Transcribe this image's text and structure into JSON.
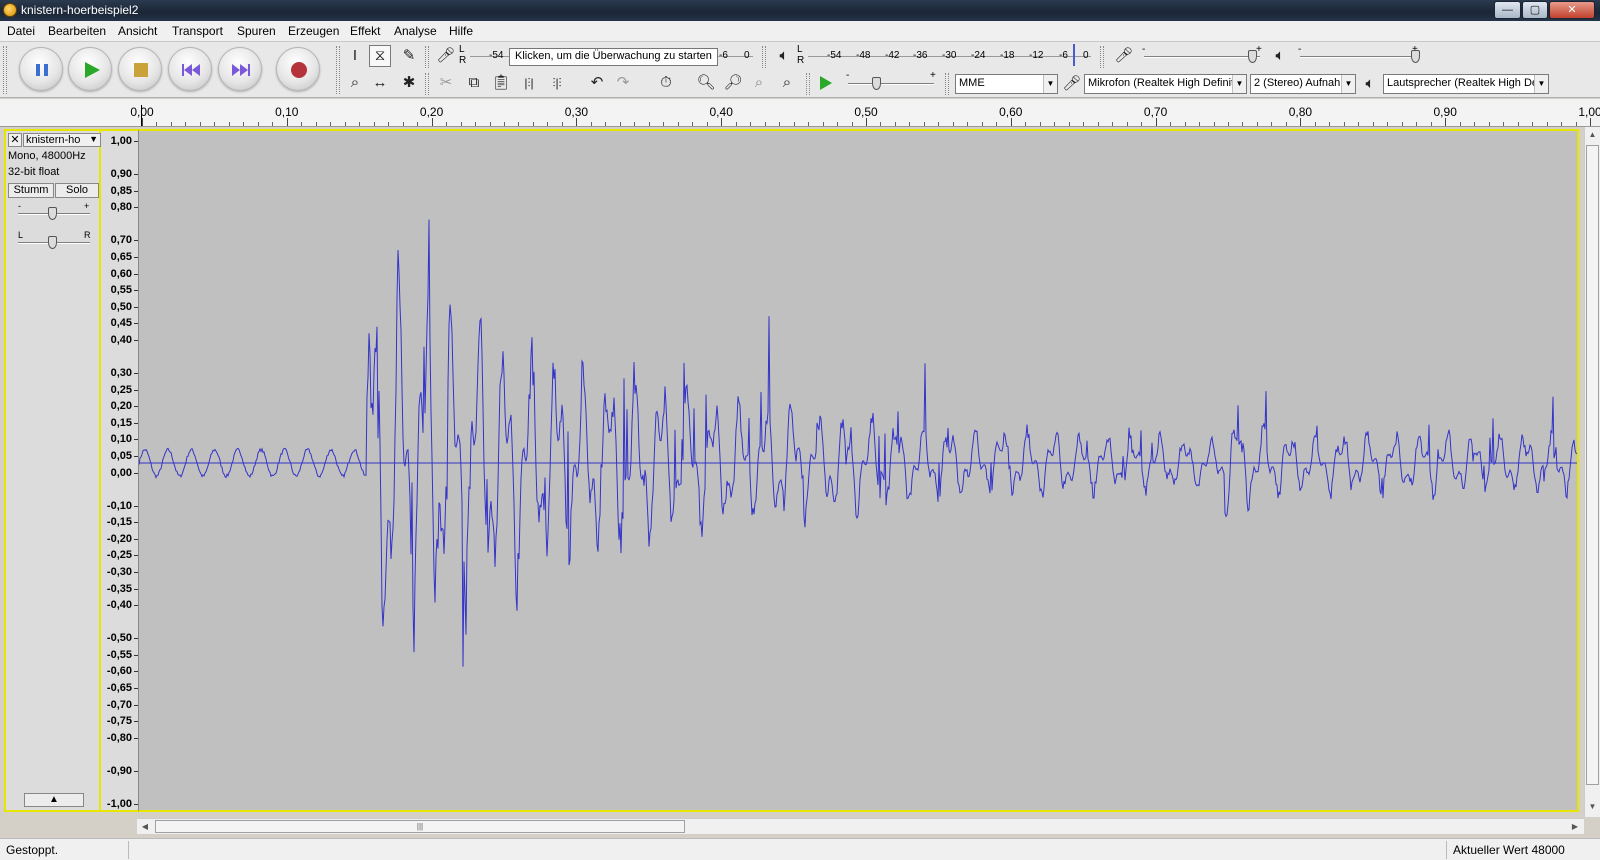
{
  "window": {
    "title": "knistern-hoerbeispiel2",
    "minimize": "—",
    "maximize": "▢",
    "close": "✕"
  },
  "menu": [
    "Datei",
    "Bearbeiten",
    "Ansicht",
    "Transport",
    "Spuren",
    "Erzeugen",
    "Effekt",
    "Analyse",
    "Hilfe"
  ],
  "transport": {
    "pause_icon": "pause-icon",
    "play_icon": "play-icon",
    "stop_icon": "stop-icon",
    "skip_start_icon": "skip-to-start-icon",
    "skip_end_icon": "skip-to-end-icon",
    "record_icon": "record-icon"
  },
  "meters": {
    "record_lr": "L R",
    "record_ticks": [
      "-54",
      "-6",
      "0"
    ],
    "record_tooltip": "Klicken, um die Überwachung zu starten",
    "play_lr": "L R",
    "play_ticks": [
      "-54",
      "-48",
      "-42",
      "-36",
      "-30",
      "-24",
      "-18",
      "-12",
      "-6",
      "0"
    ]
  },
  "mixer": {
    "minus": "-",
    "plus": "+"
  },
  "devices": {
    "host": "MME",
    "input": "Mikrofon (Realtek High Definit",
    "channels": "2 (Stereo) Aufnah",
    "output": "Lautsprecher (Realtek High De"
  },
  "timeline": {
    "labels": [
      "0,00",
      "0,10",
      "0,20",
      "0,30",
      "0,40",
      "0,50",
      "0,60",
      "0,70",
      "0,80",
      "0,90",
      "1,00"
    ]
  },
  "track": {
    "name": "knistern-ho",
    "close": "✕",
    "dropdown": "▼",
    "format": "Mono, 48000Hz",
    "bitdepth": "32-bit float",
    "mute": "Stumm",
    "solo": "Solo",
    "gain_minus": "-",
    "gain_plus": "+",
    "pan_left": "L",
    "pan_right": "R",
    "collapse": "▲"
  },
  "amplitude_labels": [
    "1,00",
    "0,90",
    "0,85",
    "0,80",
    "0,70",
    "0,65",
    "0,60",
    "0,55",
    "0,50",
    "0,45",
    "0,40",
    "0,30",
    "0,25",
    "0,20",
    "0,15",
    "0,10",
    "0,05",
    "0,00",
    "-0,10",
    "-0,15",
    "-0,20",
    "-0,25",
    "-0,30",
    "-0,35",
    "-0,40",
    "-0,50",
    "-0,55",
    "-0,60",
    "-0,65",
    "-0,70",
    "-0,75",
    "-0,80",
    "-0,90",
    "-1,00"
  ],
  "status": {
    "state": "Gestoppt.",
    "rate": "Aktueller Wert 48000"
  },
  "colors": {
    "waveform": "#3434c8",
    "selection_border": "#e6e600",
    "wave_bg": "#c0c0c0"
  }
}
